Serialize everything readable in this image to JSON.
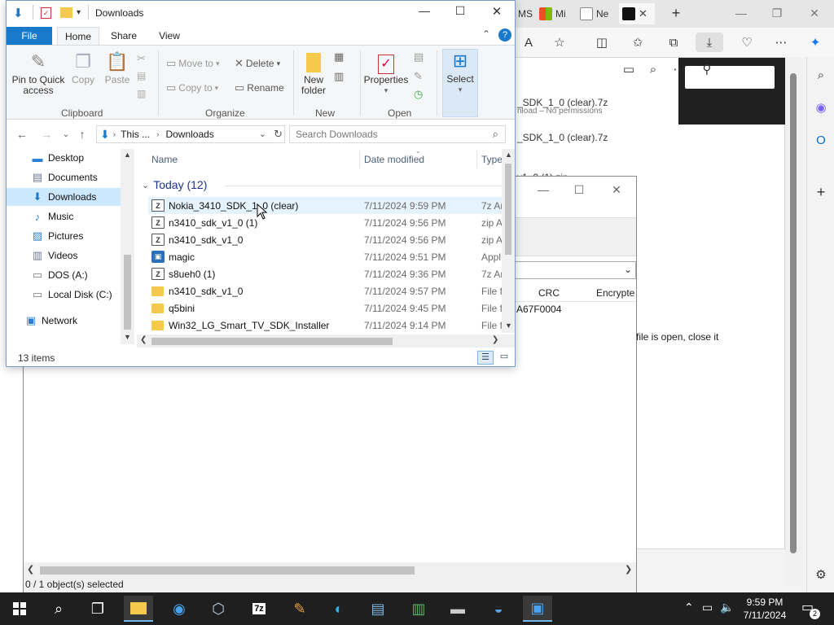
{
  "explorer": {
    "title": "Downloads",
    "ribbon_tabs": [
      "File",
      "Home",
      "Share",
      "View"
    ],
    "clipboard": {
      "pin": "Pin to Quick\naccess",
      "copy": "Copy",
      "paste": "Paste",
      "group": "Clipboard"
    },
    "organize": {
      "move_to": "Move to",
      "copy_to": "Copy to",
      "delete": "Delete",
      "rename": "Rename",
      "group": "Organize"
    },
    "new": {
      "new_folder": "New\nfolder",
      "group": "New"
    },
    "open": {
      "properties": "Properties",
      "group": "Open"
    },
    "select": {
      "label": "Select"
    },
    "breadcrumb": {
      "this_pc": "This ...",
      "current": "Downloads"
    },
    "search_placeholder": "Search Downloads",
    "nav_items": [
      {
        "label": "Desktop",
        "icon": "desktop-icon"
      },
      {
        "label": "Documents",
        "icon": "documents-icon"
      },
      {
        "label": "Downloads",
        "icon": "downloads-icon"
      },
      {
        "label": "Music",
        "icon": "music-icon"
      },
      {
        "label": "Pictures",
        "icon": "pictures-icon"
      },
      {
        "label": "Videos",
        "icon": "videos-icon"
      },
      {
        "label": "DOS (A:)",
        "icon": "drive-icon"
      },
      {
        "label": "Local Disk (C:)",
        "icon": "drive-icon"
      },
      {
        "label": "Network",
        "icon": "network-icon"
      }
    ],
    "columns": {
      "name": "Name",
      "date": "Date modified",
      "type": "Type"
    },
    "group_label": "Today (12)",
    "files": [
      {
        "name": "Nokia_3410_SDK_1_0 (clear)",
        "date": "7/11/2024 9:59 PM",
        "type": "7z Ar",
        "kind": "z"
      },
      {
        "name": "n3410_sdk_v1_0 (1)",
        "date": "7/11/2024 9:56 PM",
        "type": "zip A",
        "kind": "z"
      },
      {
        "name": "n3410_sdk_v1_0",
        "date": "7/11/2024 9:56 PM",
        "type": "zip A",
        "kind": "z"
      },
      {
        "name": "magic",
        "date": "7/11/2024 9:51 PM",
        "type": "Appl",
        "kind": "app"
      },
      {
        "name": "s8ueh0 (1)",
        "date": "7/11/2024 9:36 PM",
        "type": "7z Ar",
        "kind": "z"
      },
      {
        "name": "n3410_sdk_v1_0",
        "date": "7/11/2024 9:57 PM",
        "type": "File f",
        "kind": "folder"
      },
      {
        "name": "q5bini",
        "date": "7/11/2024 9:45 PM",
        "type": "File f",
        "kind": "folder"
      },
      {
        "name": "Win32_LG_Smart_TV_SDK_Installer",
        "date": "7/11/2024 9:14 PM",
        "type": "File f",
        "kind": "folder"
      }
    ],
    "status": "13 items"
  },
  "sevenzip": {
    "columns": {
      "crc": "CRC",
      "encrypted": "Encrypte"
    },
    "crc_value": "A67F0004",
    "message": "file is open, close it",
    "status": "0 / 1 object(s) selected"
  },
  "edge": {
    "tabs": [
      "MS",
      "Mi",
      "Ne"
    ],
    "downloads": [
      {
        "name": "_SDK_1_0 (clear).7z",
        "sub": "nload – No permissions"
      },
      {
        "name": "_SDK_1_0 (clear).7z",
        "sub": ""
      },
      {
        "name": "v1_0 (1).zip",
        "sub": ""
      }
    ]
  },
  "taskbar": {
    "time": "9:59 PM",
    "date": "7/11/2024",
    "notifications": "2"
  },
  "colors": {
    "accent": "#1979ca",
    "selection": "#cce8ff",
    "taskbar": "#1f1f1f"
  }
}
